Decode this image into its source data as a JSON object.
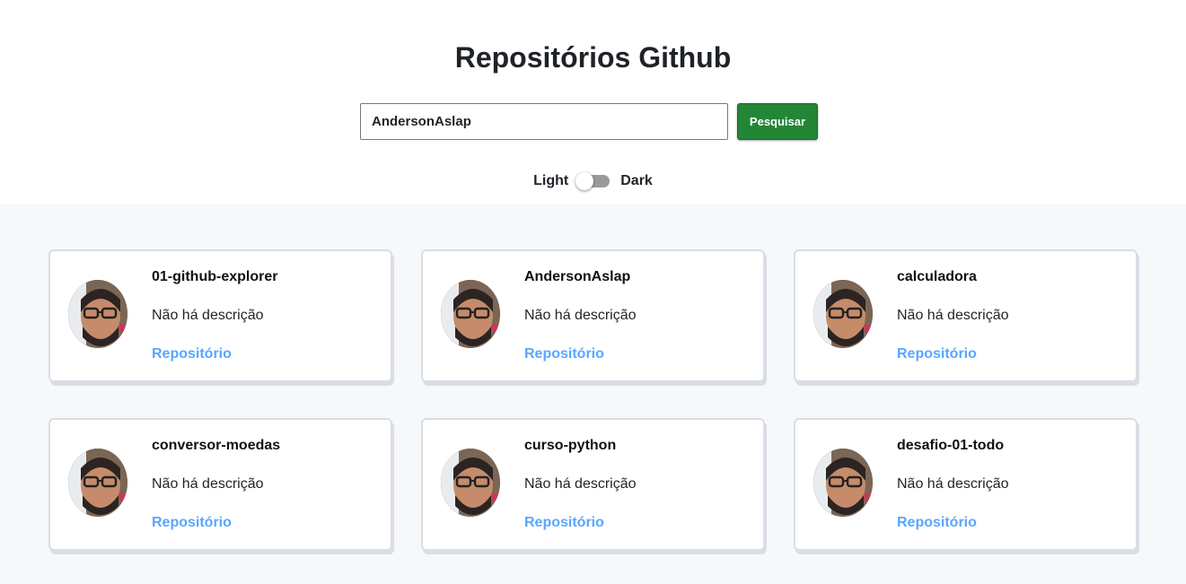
{
  "header": {
    "title": "Repositórios Github"
  },
  "search": {
    "value": "AndersonAslap",
    "button_label": "Pesquisar"
  },
  "theme": {
    "light_label": "Light",
    "dark_label": "Dark",
    "is_dark": false
  },
  "colors": {
    "accent": "#238636",
    "link": "#58a6ff",
    "background": "#f6f8fa",
    "card_border": "#d8dee4"
  },
  "repositories": [
    {
      "name": "01-github-explorer",
      "description": "Não há descrição",
      "link_label": "Repositório",
      "avatar_icon": "user-avatar"
    },
    {
      "name": "AndersonAslap",
      "description": "Não há descrição",
      "link_label": "Repositório",
      "avatar_icon": "user-avatar"
    },
    {
      "name": "calculadora",
      "description": "Não há descrição",
      "link_label": "Repositório",
      "avatar_icon": "user-avatar"
    },
    {
      "name": "conversor-moedas",
      "description": "Não há descrição",
      "link_label": "Repositório",
      "avatar_icon": "user-avatar"
    },
    {
      "name": "curso-python",
      "description": "Não há descrição",
      "link_label": "Repositório",
      "avatar_icon": "user-avatar"
    },
    {
      "name": "desafio-01-todo",
      "description": "Não há descrição",
      "link_label": "Repositório",
      "avatar_icon": "user-avatar"
    }
  ]
}
